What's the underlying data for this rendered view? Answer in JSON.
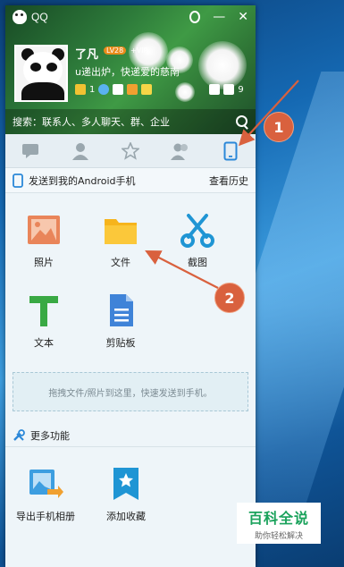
{
  "window": {
    "app_title": "QQ",
    "controls": {
      "minimize": "—",
      "close": "✕"
    }
  },
  "profile": {
    "nickname": "了凡",
    "level": "LV28",
    "vip": "+VIP",
    "signature": "u递出炉，快递爱的慈南",
    "status": {
      "count_left": "1",
      "count_right": "9"
    }
  },
  "search": {
    "placeholder": "搜索：联系人、多人聊天、群、企业"
  },
  "tabs": [
    "messages-tab",
    "contacts-tab",
    "favorites-tab",
    "groups-tab",
    "phone-tab"
  ],
  "panel": {
    "title": "发送到我的Android手机",
    "history_link": "查看历史",
    "items": [
      {
        "label": "照片",
        "icon": "photo-icon",
        "color": "#e9855a"
      },
      {
        "label": "文件",
        "icon": "folder-icon",
        "color": "#f6b41c"
      },
      {
        "label": "截图",
        "icon": "scissors-icon",
        "color": "#1f95d4"
      },
      {
        "label": "文本",
        "icon": "text-icon",
        "color": "#39a944"
      },
      {
        "label": "剪贴板",
        "icon": "clipboard-icon",
        "color": "#3f83d8"
      }
    ],
    "drop_hint": "拖拽文件/照片到这里，快速发送到手机。"
  },
  "more": {
    "title": "更多功能",
    "items": [
      {
        "label": "导出手机相册",
        "icon": "export-album-icon"
      },
      {
        "label": "添加收藏",
        "icon": "bookmark-icon"
      }
    ]
  },
  "annotations": {
    "callout_1": "1",
    "callout_2": "2",
    "color": "#d9613e"
  },
  "watermark": {
    "title": "百科全说",
    "subtitle": "助你轻松解决"
  }
}
